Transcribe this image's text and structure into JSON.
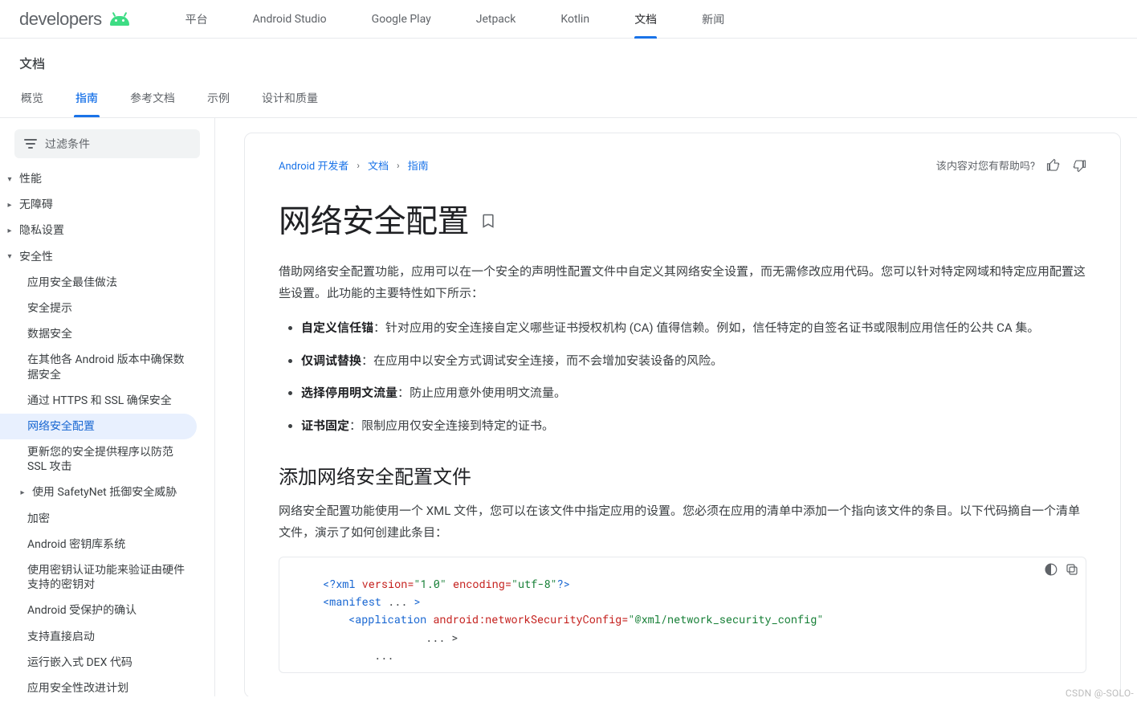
{
  "brand": "developers",
  "topnav": {
    "items": [
      "平台",
      "Android Studio",
      "Google Play",
      "Jetpack",
      "Kotlin",
      "文档",
      "新闻"
    ],
    "active_index": 5
  },
  "subbar": {
    "title": "文档",
    "tabs": [
      "概览",
      "指南",
      "参考文档",
      "示例",
      "设计和质量"
    ],
    "active_index": 1
  },
  "sidebar": {
    "filter_placeholder": "过滤条件",
    "items": [
      {
        "label": "性能",
        "depth": 1,
        "chev": "down"
      },
      {
        "label": "无障碍",
        "depth": 1,
        "chev": "right"
      },
      {
        "label": "隐私设置",
        "depth": 1,
        "chev": "right"
      },
      {
        "label": "安全性",
        "depth": 1,
        "chev": "down"
      },
      {
        "label": "应用安全最佳做法",
        "depth": 2
      },
      {
        "label": "安全提示",
        "depth": 2
      },
      {
        "label": "数据安全",
        "depth": 2
      },
      {
        "label": "在其他各 Android 版本中确保数据安全",
        "depth": 2
      },
      {
        "label": "通过 HTTPS 和 SSL 确保安全",
        "depth": 2
      },
      {
        "label": "网络安全配置",
        "depth": 2,
        "selected": true
      },
      {
        "label": "更新您的安全提供程序以防范 SSL 攻击",
        "depth": 2
      },
      {
        "label": "使用 SafetyNet 抵御安全威胁",
        "depth": 2,
        "chev": "right"
      },
      {
        "label": "加密",
        "depth": 2
      },
      {
        "label": "Android 密钥库系统",
        "depth": 2
      },
      {
        "label": "使用密钥认证功能来验证由硬件支持的密钥对",
        "depth": 2
      },
      {
        "label": "Android 受保护的确认",
        "depth": 2
      },
      {
        "label": "支持直接启动",
        "depth": 2
      },
      {
        "label": "运行嵌入式 DEX 代码",
        "depth": 2
      },
      {
        "label": "应用安全性改进计划",
        "depth": 2
      }
    ]
  },
  "content": {
    "breadcrumbs": [
      "Android 开发者",
      "文档",
      "指南"
    ],
    "helpful_prompt": "该内容对您有帮助吗?",
    "title": "网络安全配置",
    "intro": "借助网络安全配置功能，应用可以在一个安全的声明性配置文件中自定义其网络安全设置，而无需修改应用代码。您可以针对特定网域和特定应用配置这些设置。此功能的主要特性如下所示：",
    "bullets": [
      {
        "term": "自定义信任锚",
        "text": "：针对应用的安全连接自定义哪些证书授权机构 (CA) 值得信赖。例如，信任特定的自签名证书或限制应用信任的公共 CA 集。"
      },
      {
        "term": "仅调试替换",
        "text": "：在应用中以安全方式调试安全连接，而不会增加安装设备的风险。"
      },
      {
        "term": "选择停用明文流量",
        "text": "：防止应用意外使用明文流量。"
      },
      {
        "term": "证书固定",
        "text": "：限制应用仅安全连接到特定的证书。"
      }
    ],
    "section2_title": "添加网络安全配置文件",
    "section2_para": "网络安全配置功能使用一个 XML 文件，您可以在该文件中指定应用的设置。您必须在应用的清单中添加一个指向该文件的条目。以下代码摘自一个清单文件，演示了如何创建此条目：",
    "code": {
      "l1_a": "<?xml ",
      "l1_b": "version=",
      "l1_c": "\"1.0\"",
      "l1_d": " encoding=",
      "l1_e": "\"utf-8\"",
      "l1_f": "?>",
      "l2_a": "<manifest",
      "l2_b": " ... ",
      "l2_c": ">",
      "l3_a": "<application ",
      "l3_b": "android:networkSecurityConfig=",
      "l3_c": "\"@xml/network_security_config\"",
      "l4": "... >",
      "l5": "..."
    }
  },
  "watermark": "CSDN @-SOLO-"
}
